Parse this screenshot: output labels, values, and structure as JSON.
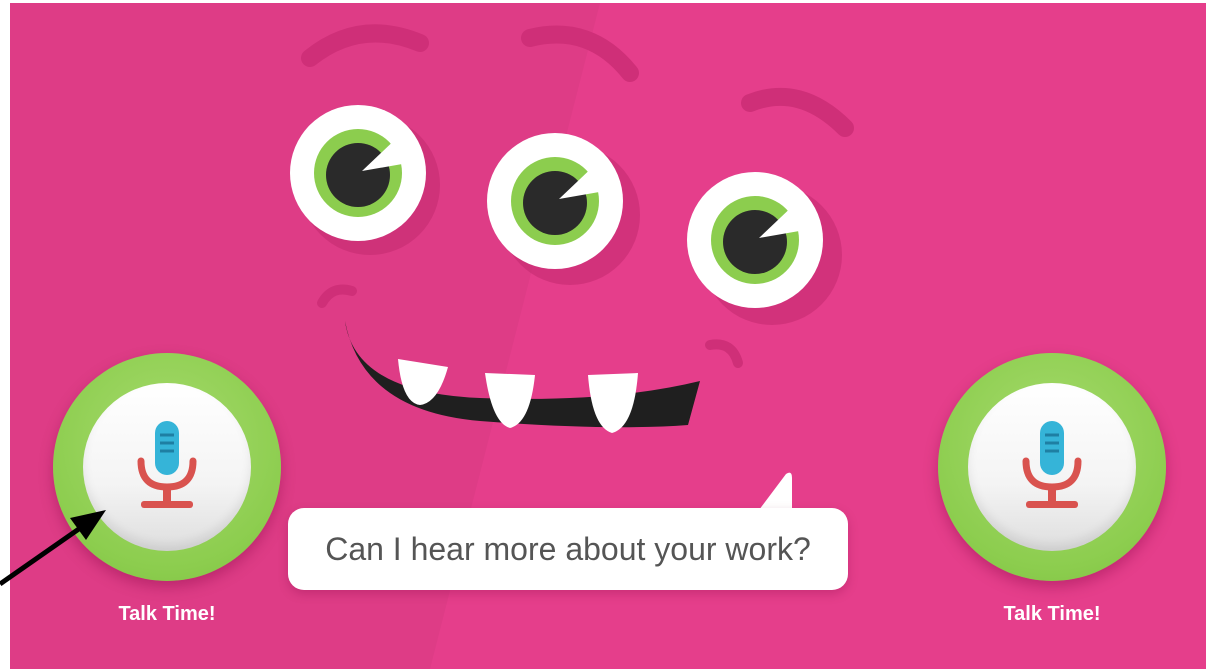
{
  "speech": {
    "text": "Can I hear more about your work?"
  },
  "talk_buttons": [
    {
      "label": "Talk Time!"
    },
    {
      "label": "Talk Time!"
    }
  ],
  "colors": {
    "background": "#e53e8b",
    "ring": "#8ccd4e",
    "pupil": "#2a2a2a",
    "mic_head": "#35b4d8",
    "mic_stand": "#d9534f"
  },
  "icons": {
    "microphone": "microphone-icon",
    "arrow": "annotation-arrow-icon"
  }
}
